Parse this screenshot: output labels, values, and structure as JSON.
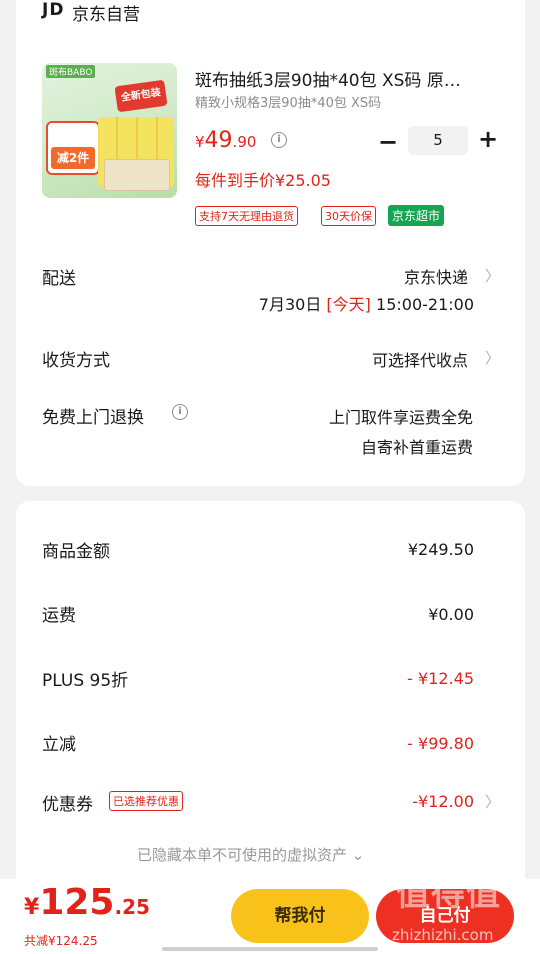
{
  "store": {
    "logo": "JD",
    "name": "京东自营"
  },
  "product": {
    "image": {
      "brand": "斑布BABO",
      "new_pack": "全新包装",
      "promo": "减2件"
    },
    "title": "斑布抽纸3层90抽*40包 XS码 原…",
    "spec": "精致小规格3层90抽*40包 XS码",
    "price": {
      "currency": "¥",
      "integer": "49",
      "decimal": ".90"
    },
    "quantity": "5",
    "minus_label": "−",
    "plus_label": "+",
    "per_price": "每件到手价¥25.05",
    "tags": [
      "支持7天无理由退货",
      "30天价保",
      "京东超市"
    ]
  },
  "delivery": {
    "label": "配送",
    "value": "京东快递",
    "date": "7月30日 ",
    "today": "[今天]",
    "time": " 15:00-21:00"
  },
  "receive": {
    "label": "收货方式",
    "value": "可选择代收点"
  },
  "returns": {
    "label": "免费上门退换",
    "line1": "上门取件享运费全免",
    "line2": "自寄补首重运费"
  },
  "summary": {
    "goods_label": "商品金额",
    "goods_value": "¥249.50",
    "shipping_label": "运费",
    "shipping_value": "¥0.00",
    "plus_label": "PLUS 95折",
    "plus_value": "- ¥12.45",
    "discount_label": "立减",
    "discount_value": "- ¥99.80",
    "coupon_label": "优惠券",
    "coupon_tag": "已选推荐优惠",
    "coupon_value": "-¥12.00",
    "hidden_assets": "已隐藏本单不可使用的虚拟资产 ⌄"
  },
  "footer": {
    "total": {
      "currency": "¥",
      "integer": "125",
      "decimal": ".25"
    },
    "saved": "共减¥124.25",
    "help_pay": "帮我付",
    "pay": "自己付",
    "watermark": "值得值",
    "watermark_url": "zhizhizhi.com"
  },
  "colors": {
    "accent_red": "#e2231a",
    "help_yellow": "#f9c21b",
    "pay_red": "#ee3022",
    "jd_green": "#16a552"
  }
}
